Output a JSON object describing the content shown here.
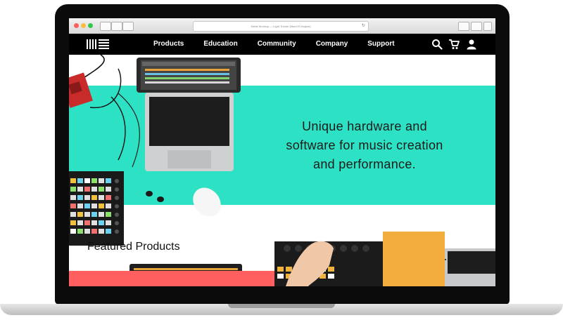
{
  "browser": {
    "url": "Safari Mockup — Light Theme (MacOS Mojave)",
    "reload_glyph": "↻"
  },
  "nav": {
    "links": [
      {
        "label": "Products"
      },
      {
        "label": "Education"
      },
      {
        "label": "Community"
      },
      {
        "label": "Company"
      },
      {
        "label": "Support"
      }
    ],
    "icons": [
      "search-icon",
      "cart-icon",
      "account-icon"
    ]
  },
  "hero": {
    "tagline_lines": [
      "Unique hardware and",
      "software for music creation",
      "and performance."
    ]
  },
  "featured": {
    "heading": "Featured Products"
  },
  "colors": {
    "hero_bg": "#2de2c4",
    "nav_bg": "#000000",
    "accent_red": "#ff5f5f",
    "accent_yellow": "#f2ad3c"
  }
}
